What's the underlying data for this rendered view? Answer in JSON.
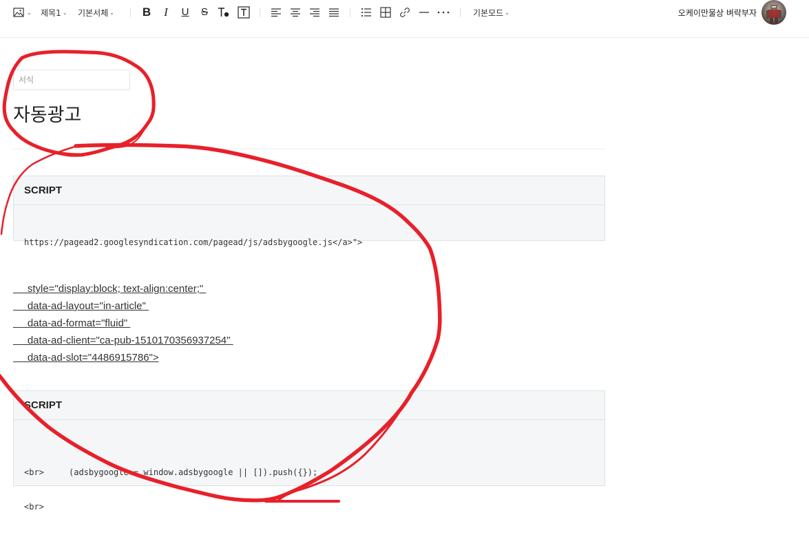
{
  "toolbar": {
    "heading_label": "제목1",
    "font_label": "기본서체",
    "mode_label": "기본모드",
    "user_name": "오케이만물상 벼락부자"
  },
  "editor": {
    "category_placeholder": "서식",
    "title": "자동광고",
    "code_blocks": [
      {
        "header": "SCRIPT",
        "lines": [
          "https://pagead2.googlesyndication.com/pagead/js/adsbygoogle.js</a>\">"
        ]
      },
      {
        "header": "SCRIPT",
        "lines": [
          "<br>     (adsbygoogle = window.adsbygoogle || []).push({});",
          "<br>"
        ]
      }
    ],
    "attribute_lines": [
      "     style=\"display:block; text-align:center;\" ",
      "     data-ad-layout=\"in-article\" ",
      "     data-ad-format=\"fluid\" ",
      "     data-ad-client=\"ca-pub-1510170356937254\" ",
      "     data-ad-slot=\"4486915786\">"
    ]
  },
  "colors": {
    "annotation": "#e8202a",
    "code_bg": "#f5f6f8"
  },
  "icons": [
    "image-icon",
    "bold-icon",
    "italic-icon",
    "underline-icon",
    "strikethrough-icon",
    "text-color-icon",
    "text-background-icon",
    "align-left-icon",
    "align-center-icon",
    "align-right-icon",
    "align-justify-icon",
    "bullet-list-icon",
    "table-icon",
    "link-icon",
    "horizontal-line-icon",
    "more-icon"
  ]
}
